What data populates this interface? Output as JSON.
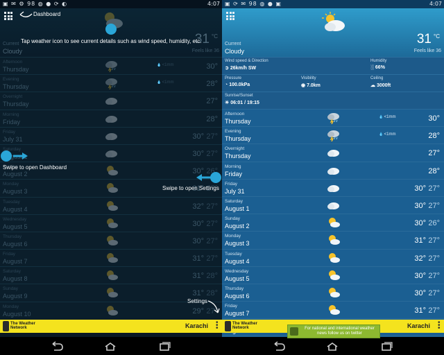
{
  "statusbar": {
    "left_icons": "▣ ✉ ⚙ 98 ◍ ● ⟳ ◐",
    "right_icons": "▣ ⟳ ✉ 98 ◍ ● ▣",
    "time_left": "4:07",
    "time_right": "4:07"
  },
  "colors": {
    "accent": "#2aa6d8",
    "footer": "#f4e31e",
    "row": "#1b5f92"
  },
  "current": {
    "label": "Current",
    "condition": "Cloudy",
    "temp": "31",
    "unit": "°C",
    "feels_like": "Feels like 36"
  },
  "details": {
    "wind_title": "Wind speed & Direction",
    "wind_value": "26km/h SW",
    "humidity_title": "Humidity",
    "humidity_value": "66%",
    "pressure_title": "Pressure",
    "pressure_value": "100.0kPa",
    "visibility_title": "Visibility",
    "visibility_value": "7.0km",
    "ceiling_title": "Ceiling",
    "ceiling_value": "3000ft",
    "sun_title": "Sunrise/Sunset",
    "sun_value": "06:01 / 19:15"
  },
  "forecast": [
    {
      "day": "Afternoon",
      "date": "Thursday",
      "icon": "storm-icon",
      "precip": "<1mm",
      "hi": "30°",
      "lo": ""
    },
    {
      "day": "Evening",
      "date": "Thursday",
      "icon": "storm-icon",
      "precip": "<1mm",
      "hi": "28°",
      "lo": ""
    },
    {
      "day": "Overnight",
      "date": "Thursday",
      "icon": "cloud-icon",
      "precip": "",
      "hi": "27°",
      "lo": ""
    },
    {
      "day": "Morning",
      "date": "Friday",
      "icon": "cloud-icon",
      "precip": "",
      "hi": "28°",
      "lo": ""
    },
    {
      "day": "Friday",
      "date": "July 31",
      "icon": "cloud-icon",
      "precip": "",
      "hi": "30°",
      "lo": "27°"
    },
    {
      "day": "Saturday",
      "date": "August 1",
      "icon": "cloud-icon",
      "precip": "",
      "hi": "30°",
      "lo": "27°"
    },
    {
      "day": "Sunday",
      "date": "August 2",
      "icon": "partly-sunny-icon",
      "precip": "",
      "hi": "30°",
      "lo": "26°"
    },
    {
      "day": "Monday",
      "date": "August 3",
      "icon": "partly-sunny-icon",
      "precip": "",
      "hi": "31°",
      "lo": "27°"
    },
    {
      "day": "Tuesday",
      "date": "August 4",
      "icon": "partly-sunny-icon",
      "precip": "",
      "hi": "32°",
      "lo": "27°"
    },
    {
      "day": "Wednesday",
      "date": "August 5",
      "icon": "partly-sunny-icon",
      "precip": "",
      "hi": "30°",
      "lo": "27°"
    },
    {
      "day": "Thursday",
      "date": "August 6",
      "icon": "partly-sunny-icon",
      "precip": "",
      "hi": "30°",
      "lo": "27°"
    },
    {
      "day": "Friday",
      "date": "August 7",
      "icon": "partly-sunny-icon",
      "precip": "",
      "hi": "31°",
      "lo": "27°"
    },
    {
      "day": "Saturday",
      "date": "August 8",
      "icon": "partly-sunny-icon",
      "precip": "",
      "hi": "31°",
      "lo": "28°"
    },
    {
      "day": "Sunday",
      "date": "August 9",
      "icon": "partly-sunny-icon",
      "precip": "",
      "hi": "31°",
      "lo": "28°"
    },
    {
      "day": "Monday",
      "date": "August 10",
      "icon": "partly-sunny-icon",
      "precip": "",
      "hi": "29°",
      "lo": "27°"
    }
  ],
  "overlay": {
    "dashboard": "Dashboard",
    "tap_hint": "Tap weather icon to see current details such as wind speed, humidity, etc.",
    "swipe_dashboard": "Swipe to open Dashboard",
    "swipe_settings": "Swipe to open Settings",
    "settings": "Settings"
  },
  "footer": {
    "brand_line1": "The Weather",
    "brand_line2": "Network",
    "city": "Karachi"
  },
  "banner": {
    "line1": "For national and international weather",
    "line2": "news follow us on twitter"
  }
}
